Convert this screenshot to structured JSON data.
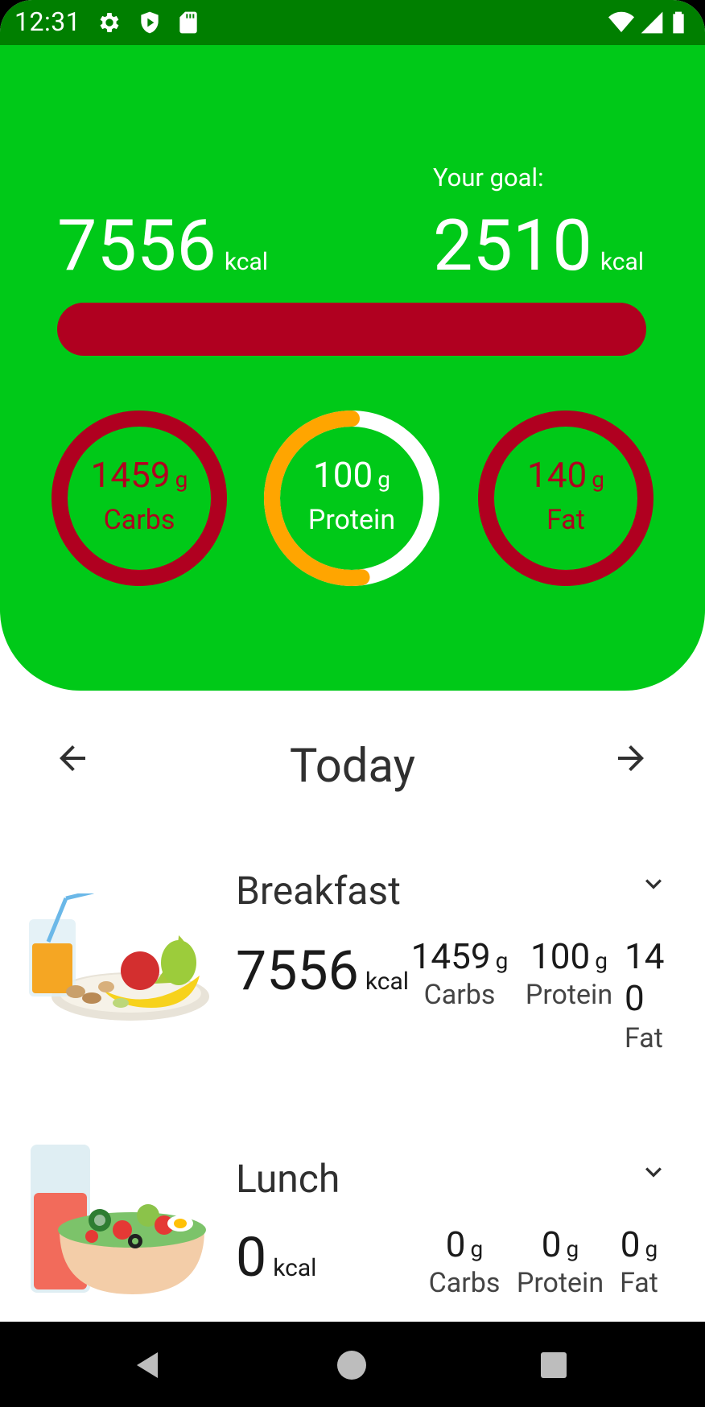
{
  "status_bar": {
    "time": "12:31",
    "icons": [
      "settings-icon",
      "shield-play-icon",
      "sd-card-icon",
      "wifi-icon",
      "signal-icon",
      "battery-icon"
    ]
  },
  "summary": {
    "consumed_value": "7556",
    "consumed_unit": "kcal",
    "goal_label": "Your goal:",
    "goal_value": "2510",
    "goal_unit": "kcal",
    "progress_fraction": 1.0
  },
  "macros": [
    {
      "value": "1459",
      "unit": "g",
      "label": "Carbs",
      "fraction": 1.0,
      "state": "over"
    },
    {
      "value": "100",
      "unit": "g",
      "label": "Protein",
      "fraction": 0.52,
      "state": "normal"
    },
    {
      "value": "140",
      "unit": "g",
      "label": "Fat",
      "fraction": 1.0,
      "state": "over"
    }
  ],
  "day_nav": {
    "title": "Today",
    "prev_icon": "arrow-left-icon",
    "next_icon": "arrow-right-icon"
  },
  "meals": [
    {
      "name": "Breakfast",
      "kcal": "7556",
      "kcal_unit": "kcal",
      "carbs": "1459",
      "protein": "100",
      "fat_line1": "14",
      "fat_line2": "0",
      "unit": "g",
      "carbs_label": "Carbs",
      "protein_label": "Protein",
      "fat_label": "Fat",
      "image": "breakfast-fruit-plate-image"
    },
    {
      "name": "Lunch",
      "kcal": "0",
      "kcal_unit": "kcal",
      "carbs": "0",
      "protein": "0",
      "fat": "0",
      "unit": "g",
      "carbs_label": "Carbs",
      "protein_label": "Protein",
      "fat_label": "Fat",
      "image": "lunch-salad-bowl-image"
    }
  ],
  "colors": {
    "header_green": "#00c918",
    "status_green": "#007f00",
    "over_red": "#b00020",
    "protein_orange": "#ffa500"
  }
}
